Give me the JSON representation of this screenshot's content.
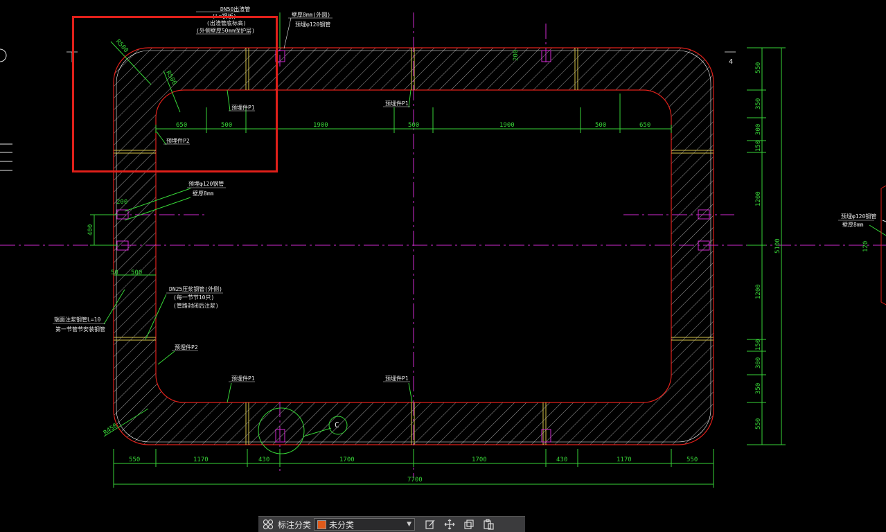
{
  "colors": {
    "background": "#000000",
    "outline": "#e0201a",
    "dimension": "#37d437",
    "axis": "#d12ad1",
    "hatch": "#c8c8c8",
    "highlight": "#e0201a"
  },
  "drawing": {
    "dims_bottom": [
      "550",
      "1170",
      "430",
      "1700",
      "1700",
      "430",
      "1170",
      "550"
    ],
    "dim_total_bottom": "7700",
    "dims_top_inner": [
      "650",
      "500",
      "1900",
      "500",
      "1900",
      "500",
      "650"
    ],
    "dims_right": [
      "550",
      "350",
      "300",
      "150",
      "1200",
      "1200",
      "150",
      "300",
      "350",
      "550"
    ],
    "dim_total_right": "5100",
    "dims_left": [
      "200",
      "400",
      "50",
      "500"
    ],
    "radius_labels": [
      "R500",
      "R500",
      "R450"
    ],
    "small_dim_top": "200",
    "right_small_dim": "120",
    "section_mark": "C",
    "edge_mark": "4",
    "ann_top_1": "DN50出渣管",
    "ann_top_2": "(L=钢板)",
    "ann_top_3": "(出渣管底标高)",
    "ann_top_4": "(外侧壁厚50mm保护层)",
    "ann_top_right_1": "壁厚8mm(外圆)",
    "ann_top_right_2": "预埋φ120钢管",
    "ann_p1": [
      "预埋件P1",
      "预埋件P1",
      "预埋件P1",
      "预埋件P1"
    ],
    "ann_p2": [
      "预埋件P2",
      "预埋件P2"
    ],
    "ann_left_pipe_1": "预埋φ120钢管",
    "ann_left_pipe_2": "壁厚8mm",
    "ann_dn25_1": "DN25压浆钢管(外侧)",
    "ann_dn25_2": "(每一节节10只)",
    "ann_dn25_3": "(管路封闭后注浆)",
    "ann_left_low_1": "端面注浆钢管L=10",
    "ann_left_low_2": "第一节管节安装钢管",
    "ann_right_pipe_1": "预埋φ120钢管",
    "ann_right_pipe_2": "壁厚8mm"
  },
  "toolbar": {
    "grid_icon": "grid-icon",
    "label": "标注分类",
    "select_value": "未分类",
    "swatch_color": "#e05a1a",
    "tools": [
      "edit-icon",
      "move-icon",
      "copy-icon",
      "paste-icon"
    ]
  }
}
